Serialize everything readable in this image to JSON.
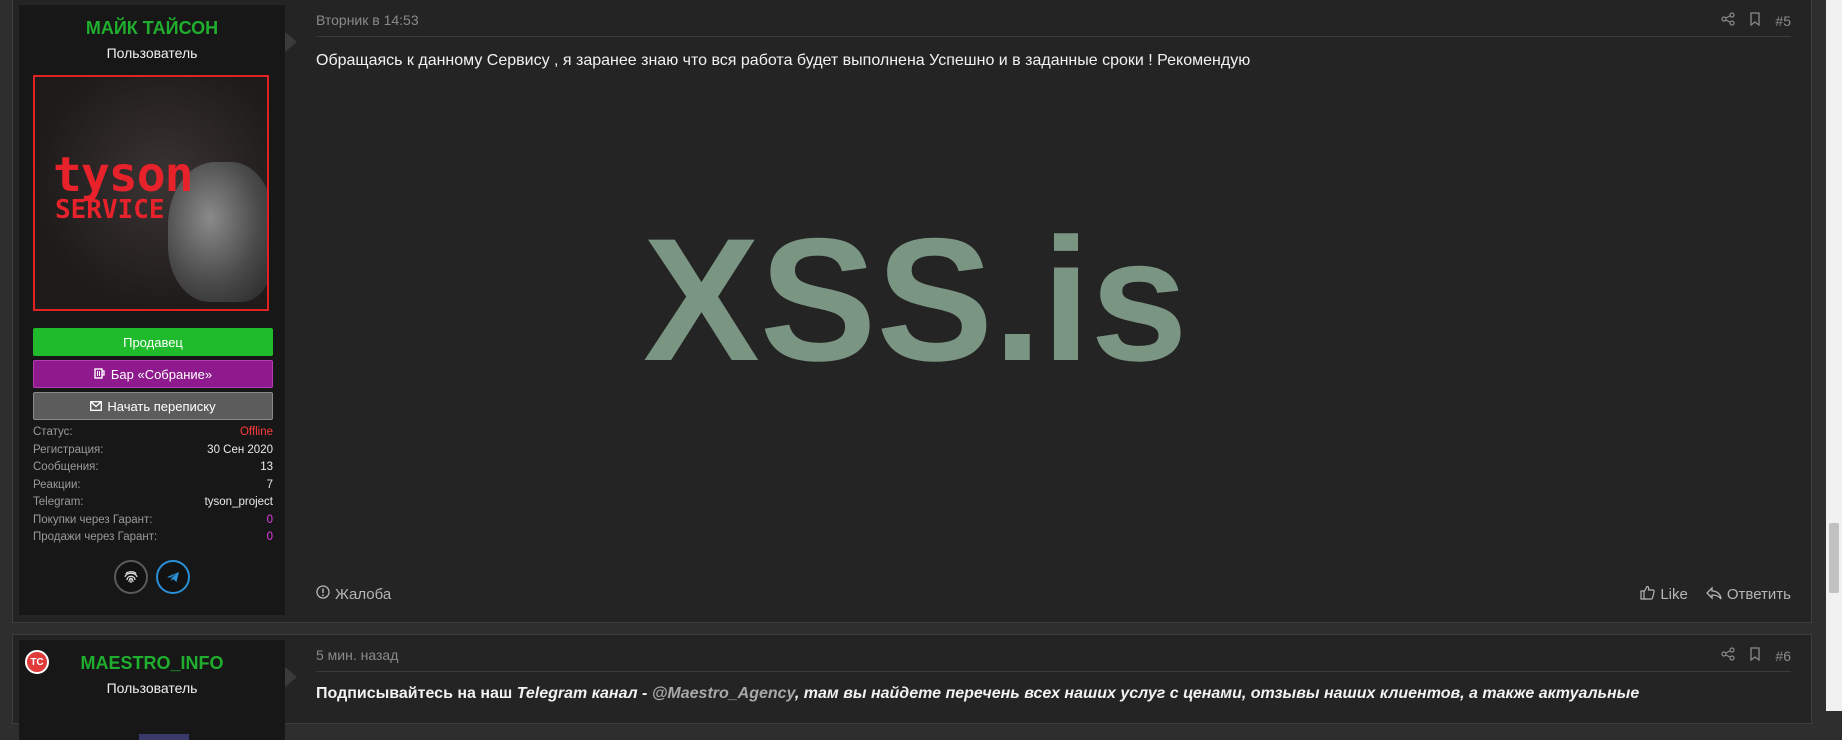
{
  "post1": {
    "username": "МАЙК ТАЙСОН",
    "role": "Пользователь",
    "avatar_text1": "tyson",
    "avatar_text2": "SERVICE",
    "btn_seller": "Продавец",
    "btn_bar": "Бар «Собрание»",
    "btn_message": "Начать переписку",
    "stats": [
      {
        "key": "Статус:",
        "value": "Offline"
      },
      {
        "key": "Регистрация:",
        "value": "30 Сен 2020"
      },
      {
        "key": "Сообщения:",
        "value": "13"
      },
      {
        "key": "Реакции:",
        "value": "7"
      },
      {
        "key": "Telegram:",
        "value": "tyson_project"
      },
      {
        "key": "Покупки через Гарант:",
        "value": "0"
      },
      {
        "key": "Продажи через Гарант:",
        "value": "0"
      }
    ],
    "date": "Вторник в 14:53",
    "number": "#5",
    "message": "Обращаясь к данному Сервису , я заранее знаю что вся работа будет выполнена Успешно и в заданные сроки ! Рекомендую",
    "logo_text": "XSS.is",
    "report": "Жалоба",
    "like": "Like",
    "reply": "Ответить"
  },
  "post2": {
    "avatar_initials": "TC",
    "username": "MAESTRO_INFO",
    "role": "Пользователь",
    "date": "5 мин. назад",
    "number": "#6",
    "msg_part1": "Подписывайтесь на наш ",
    "msg_part2": "Telegram канал - ",
    "msg_mention": "@Maestro_Agency",
    "msg_part3": ", там вы найдете перечень всех наших услуг с ценами, отзывы наших клиентов, а также актуальные"
  },
  "colors": {
    "username_green": "#1fae2d",
    "offline_red": "#ff3b3b",
    "guarantee_pink": "#e23de2",
    "logo_gray": "#7b9583"
  },
  "icons": [
    "share-icon",
    "bookmark-icon",
    "fingerprint-icon",
    "telegram-icon",
    "beer-icon",
    "envelope-icon",
    "warning-icon",
    "thumbs-up-icon",
    "reply-icon"
  ]
}
